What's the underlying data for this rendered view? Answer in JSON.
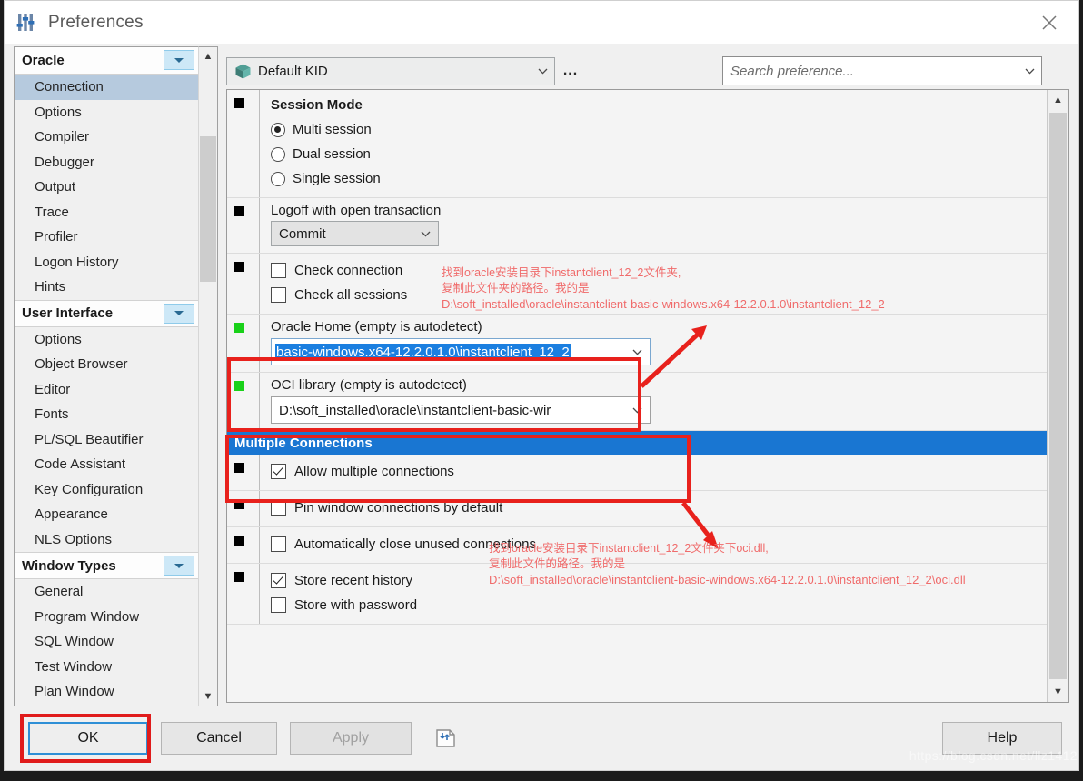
{
  "window": {
    "title": "Preferences",
    "app_icon": "sliders-icon",
    "close_icon": "close-icon"
  },
  "sidebar": {
    "scroll_up_icon": "chevron-up-icon",
    "scroll_down_icon": "chevron-down-icon",
    "groups": [
      {
        "label": "Oracle",
        "expander_icon": "chevron-down-icon",
        "items": [
          {
            "label": "Connection",
            "selected": true
          },
          {
            "label": "Options",
            "selected": false
          },
          {
            "label": "Compiler",
            "selected": false
          },
          {
            "label": "Debugger",
            "selected": false
          },
          {
            "label": "Output",
            "selected": false
          },
          {
            "label": "Trace",
            "selected": false
          },
          {
            "label": "Profiler",
            "selected": false
          },
          {
            "label": "Logon History",
            "selected": false
          },
          {
            "label": "Hints",
            "selected": false
          }
        ]
      },
      {
        "label": "User Interface",
        "expander_icon": "chevron-down-icon",
        "items": [
          {
            "label": "Options",
            "selected": false
          },
          {
            "label": "Object Browser",
            "selected": false
          },
          {
            "label": "Editor",
            "selected": false
          },
          {
            "label": "Fonts",
            "selected": false
          },
          {
            "label": "PL/SQL Beautifier",
            "selected": false
          },
          {
            "label": "Code Assistant",
            "selected": false
          },
          {
            "label": "Key Configuration",
            "selected": false
          },
          {
            "label": "Appearance",
            "selected": false
          },
          {
            "label": "NLS Options",
            "selected": false
          }
        ]
      },
      {
        "label": "Window Types",
        "expander_icon": "chevron-down-icon",
        "items": [
          {
            "label": "General",
            "selected": false
          },
          {
            "label": "Program Window",
            "selected": false
          },
          {
            "label": "SQL Window",
            "selected": false
          },
          {
            "label": "Test Window",
            "selected": false
          },
          {
            "label": "Plan Window",
            "selected": false
          }
        ]
      }
    ]
  },
  "toolbar": {
    "kid_icon": "cube-icon",
    "kid_value": "Default KID",
    "kid_caret_icon": "chevron-down-icon",
    "more_button": "...",
    "search_placeholder": "Search preference...",
    "search_value": "",
    "search_caret_icon": "chevron-down-icon"
  },
  "settings": {
    "scroll_up_icon": "chevron-up-icon",
    "scroll_down_icon": "chevron-down-icon",
    "session_mode": {
      "title": "Session Mode",
      "options": [
        {
          "label": "Multi session",
          "checked": true
        },
        {
          "label": "Dual session",
          "checked": false
        },
        {
          "label": "Single session",
          "checked": false
        }
      ]
    },
    "logoff": {
      "label": "Logoff with open transaction",
      "value": "Commit",
      "caret_icon": "chevron-down-icon"
    },
    "check_connection": {
      "label": "Check connection",
      "checked": false
    },
    "check_all_sessions": {
      "label": "Check all sessions",
      "checked": false
    },
    "oracle_home": {
      "label": "Oracle Home (empty is autodetect)",
      "value": "basic-windows.x64-12.2.0.1.0\\instantclient_12_2",
      "caret_icon": "chevron-down-icon"
    },
    "oci_library": {
      "label": "OCI library (empty is autodetect)",
      "value": "D:\\soft_installed\\oracle\\instantclient-basic-wir",
      "caret_icon": "chevron-down-icon"
    },
    "multiple_connections_band": "Multiple Connections",
    "allow_multiple": {
      "label": "Allow multiple connections",
      "checked": true
    },
    "pin_window": {
      "label": "Pin window connections by default",
      "checked": false
    },
    "auto_close": {
      "label": "Automatically close unused connections",
      "checked": false
    },
    "store_recent": {
      "label": "Store recent history",
      "checked": true
    },
    "store_password": {
      "label": "Store with password",
      "checked": false
    }
  },
  "footer": {
    "ok": "OK",
    "cancel": "Cancel",
    "apply": "Apply",
    "help": "Help",
    "export_icon": "import-export-icon"
  },
  "annotations": {
    "oracle_home_note": {
      "line1": "找到oracle安装目录下instantclient_12_2文件夹,",
      "line2": "复制此文件夹的路径。我的是",
      "line3": "D:\\soft_installed\\oracle\\instantclient-basic-windows.x64-12.2.0.1.0\\instantclient_12_2"
    },
    "oci_note": {
      "line1": "找到oracle安装目录下instantclient_12_2文件夹下oci.dll,",
      "line2": "复制此文件的路径。我的是",
      "line3": "D:\\soft_installed\\oracle\\instantclient-basic-windows.x64-12.2.0.1.0\\instantclient_12_2\\oci.dll"
    }
  },
  "watermark": "https://blog.csdn.net/llz1412",
  "colors": {
    "accent_blue": "#1976d2",
    "annotation_red": "#f06b6b",
    "box_red": "#e8211c",
    "selection_blue": "#1b7fe0",
    "marker_green": "#19d119"
  }
}
